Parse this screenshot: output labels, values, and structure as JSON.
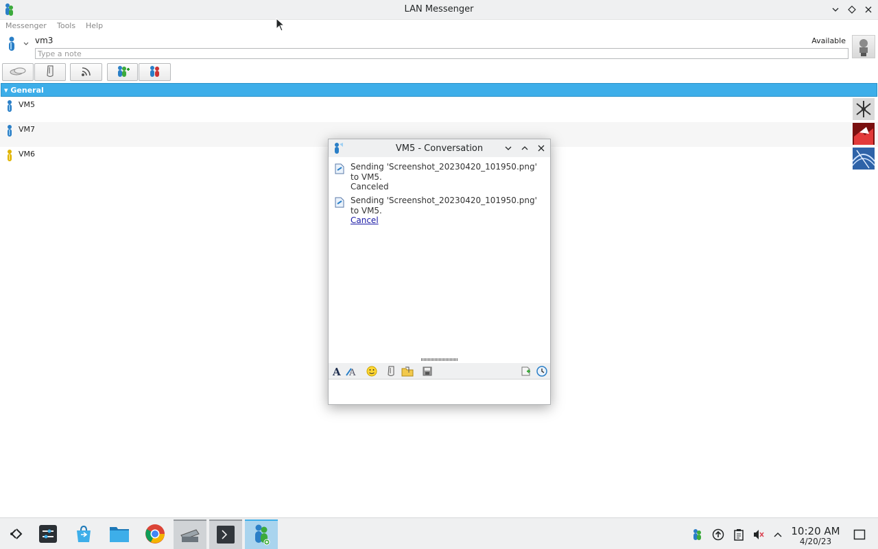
{
  "window": {
    "title": "LAN Messenger"
  },
  "menu": {
    "items": [
      "Messenger",
      "Tools",
      "Help"
    ]
  },
  "user": {
    "name": "vm3",
    "status": "Available",
    "note_placeholder": "Type a note"
  },
  "toolbar": {
    "icons": [
      "chat-bubble-icon",
      "file-transfer-icon",
      "broadcast-icon",
      "add-contact-icon",
      "network-contacts-icon"
    ]
  },
  "group": {
    "name": "General"
  },
  "contacts": [
    {
      "name": "VM5",
      "status_color": "#2a7fc7"
    },
    {
      "name": "VM7",
      "status_color": "#2a7fc7"
    },
    {
      "name": "VM6",
      "status_color": "#e0b400"
    }
  ],
  "conversation": {
    "title": "VM5 - Conversation",
    "messages": [
      {
        "text": "Sending 'Screenshot_20230420_101950.png' to VM5.",
        "status": "Canceled"
      },
      {
        "text": "Sending 'Screenshot_20230420_101950.png' to VM5.",
        "action": "Cancel"
      }
    ],
    "compose_value": ""
  },
  "taskbar": {
    "apps": [
      "app-launcher-icon",
      "settings-icon",
      "discover-store-icon",
      "file-manager-icon",
      "chrome-icon",
      "scanner-icon",
      "terminal-icon",
      "lan-messenger-icon"
    ],
    "time": "10:20 AM",
    "date": "4/20/23"
  },
  "colors": {
    "accent": "#3daee9",
    "link": "#1a1aa6"
  }
}
